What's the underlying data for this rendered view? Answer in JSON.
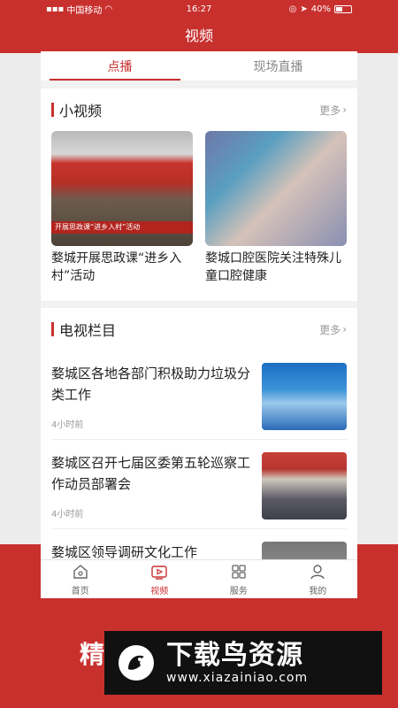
{
  "status_bar": {
    "carrier": "中国移动",
    "time": "16:27",
    "battery": "40%"
  },
  "header": {
    "title": "视频"
  },
  "tabs": [
    {
      "label": "点播",
      "active": true
    },
    {
      "label": "现场直播",
      "active": false
    }
  ],
  "short_videos": {
    "title": "小视频",
    "more": "更多",
    "items": [
      {
        "title": "婺城开展思政课“进乡入村”活动",
        "caption": "开展思政课“进乡入村”活动"
      },
      {
        "title": "婺城口腔医院关注特殊儿童口腔健康"
      }
    ]
  },
  "tv_columns": {
    "title": "电视栏目",
    "more": "更多",
    "items": [
      {
        "title": "婺城区各地各部门积极助力垃圾分类工作",
        "time": "4小时前"
      },
      {
        "title": "婺城区召开七届区委第五轮巡察工作动员部署会",
        "time": "4小时前"
      },
      {
        "title": "婺城区领导调研文化工作",
        "time": ""
      }
    ]
  },
  "tabbar": [
    {
      "label": "首页",
      "icon": "home-icon",
      "active": false
    },
    {
      "label": "视频",
      "icon": "video-icon",
      "active": true
    },
    {
      "label": "服务",
      "icon": "grid-icon",
      "active": false
    },
    {
      "label": "我的",
      "icon": "user-icon",
      "active": false
    }
  ],
  "promo": {
    "text": "精"
  },
  "watermark": {
    "title": "下载鸟资源",
    "url": "www.xiazainiao.com"
  },
  "colors": {
    "accent": "#c8302e"
  }
}
